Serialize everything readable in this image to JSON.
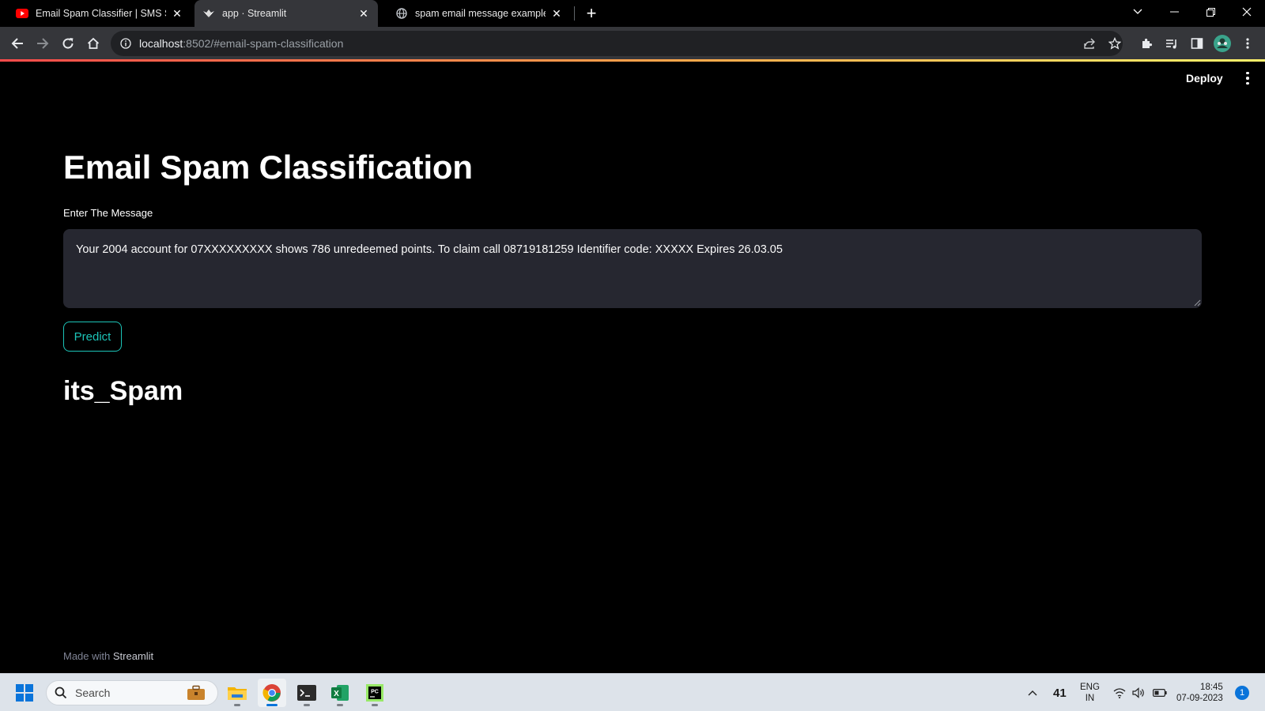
{
  "browser": {
    "tabs": [
      {
        "title": "Email Spam Classifier | SMS Spam",
        "favicon": "youtube-icon",
        "active": false
      },
      {
        "title": "app · Streamlit",
        "favicon": "streamlit-icon",
        "active": true
      },
      {
        "title": "spam email message example - G",
        "favicon": "globe-icon",
        "active": false
      }
    ],
    "url_host": "localhost",
    "url_path": ":8502/#email-spam-classification"
  },
  "app": {
    "deploy_label": "Deploy",
    "title": "Email Spam Classification",
    "input_label": "Enter The Message",
    "message_value": "Your 2004 account for 07XXXXXXXXX shows 786 unredeemed points. To claim call 08719181259 Identifier code: XXXXX Expires 26.03.05",
    "predict_label": "Predict",
    "result": "its_Spam",
    "footer_prefix": "Made with",
    "footer_brand": "Streamlit",
    "colors": {
      "accent": "#1cc4b8",
      "background": "#000000",
      "input_bg": "#262730"
    }
  },
  "taskbar": {
    "search_placeholder": "Search",
    "apps": [
      "file-explorer-icon",
      "chrome-icon",
      "terminal-icon",
      "excel-icon",
      "pycharm-icon"
    ],
    "weather_value": "41",
    "lang_top": "ENG",
    "lang_bottom": "IN",
    "time": "18:45",
    "date": "07-09-2023",
    "notification_count": "1"
  }
}
